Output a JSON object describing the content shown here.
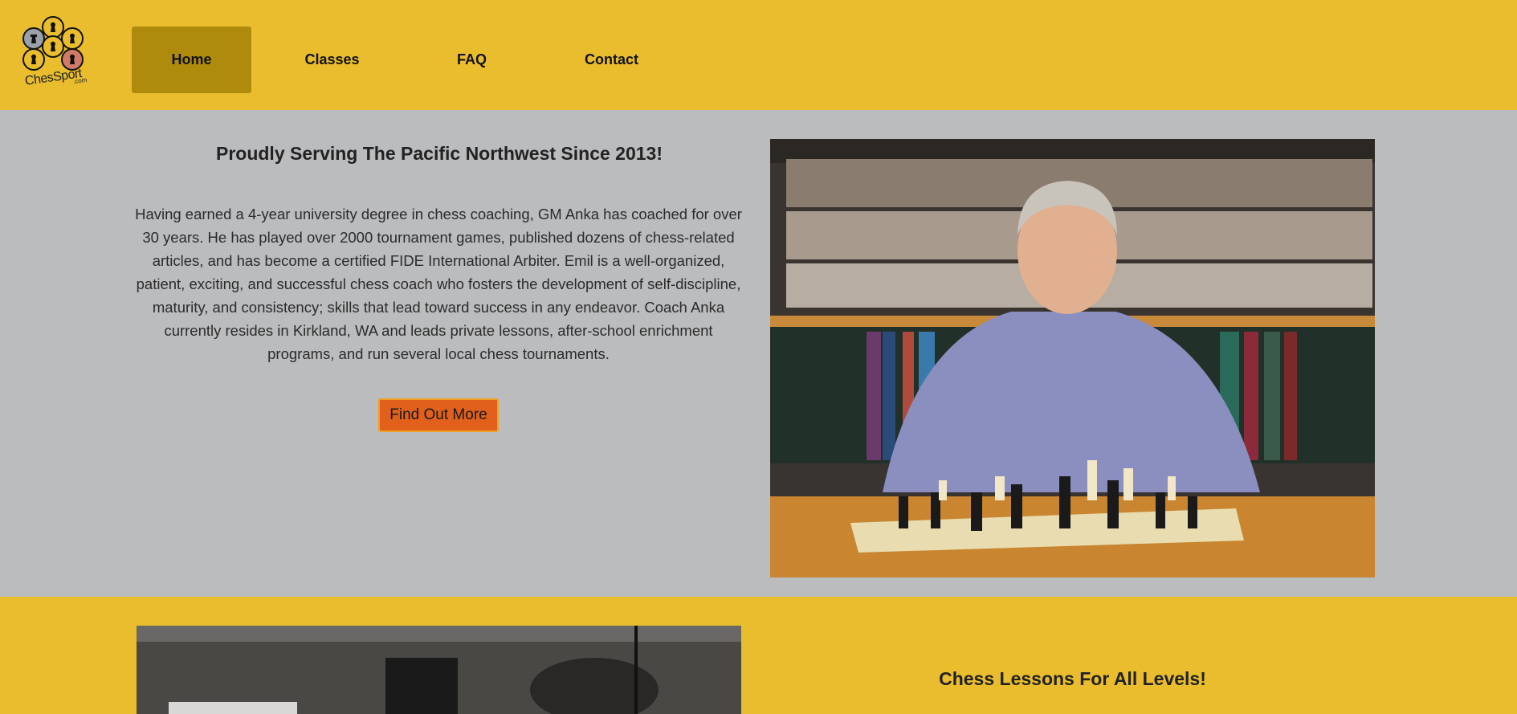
{
  "nav": {
    "logo_text": "ChesSport",
    "logo_sub": ".com",
    "items": [
      {
        "label": "Home",
        "active": true
      },
      {
        "label": "Classes",
        "active": false
      },
      {
        "label": "FAQ",
        "active": false
      },
      {
        "label": "Contact",
        "active": false
      }
    ]
  },
  "hero": {
    "title": "Proudly Serving The Pacific Northwest Since 2013!",
    "text": "Having earned a 4-year university degree in chess coaching, GM Anka has coached for over 30 years. He has played over 2000 tournament games, published dozens of chess-related articles, and has become a certified FIDE International Arbiter. Emil is a well-organized, patient, exciting, and successful chess coach who fosters the development of self-discipline, maturity, and consistency; skills that lead toward success in any endeavor. Coach Anka currently resides in Kirkland, WA and leads private lessons, after-school enrichment programs, and run several local chess tournaments.",
    "button": "Find Out More"
  },
  "section2": {
    "title": "Chess Lessons For All Levels!"
  },
  "colors": {
    "brand_yellow": "#e9bd2e",
    "nav_active": "#ae8b0d",
    "hero_bg": "#bbbcbe",
    "button_orange": "#e0601c"
  }
}
